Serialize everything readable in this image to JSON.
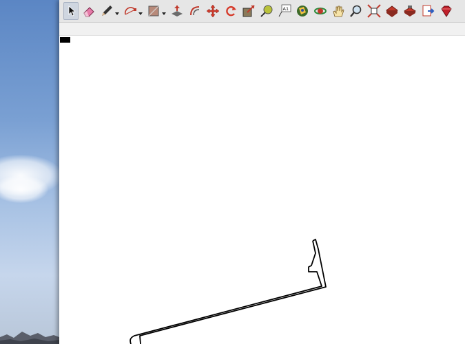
{
  "window": {
    "toolbar_tools": [
      {
        "name": "select-tool",
        "icon": "cursor-arrow-icon",
        "active": true
      },
      {
        "name": "eraser-tool",
        "icon": "eraser-icon"
      },
      {
        "name": "line-tool",
        "icon": "pencil-icon",
        "has_dropdown": true
      },
      {
        "name": "arc-tool",
        "icon": "arc-icon",
        "has_dropdown": true
      },
      {
        "name": "rectangle-tool",
        "icon": "rectangle-icon",
        "has_dropdown": true
      },
      {
        "name": "push-pull-tool",
        "icon": "push-pull-icon"
      },
      {
        "name": "offset-tool",
        "icon": "offset-icon"
      },
      {
        "name": "move-tool",
        "icon": "move-icon"
      },
      {
        "name": "rotate-tool",
        "icon": "rotate-icon"
      },
      {
        "name": "scale-tool",
        "icon": "scale-icon"
      },
      {
        "name": "tape-measure-tool",
        "icon": "tape-measure-icon"
      },
      {
        "name": "text-tool",
        "icon": "text-icon",
        "label": "A1"
      },
      {
        "name": "paint-bucket-tool",
        "icon": "paint-bucket-icon"
      },
      {
        "name": "orbit-tool",
        "icon": "orbit-icon"
      },
      {
        "name": "pan-tool",
        "icon": "hand-icon"
      },
      {
        "name": "zoom-tool",
        "icon": "magnifier-icon"
      },
      {
        "name": "zoom-extents-tool",
        "icon": "zoom-extents-icon"
      },
      {
        "name": "warehouse-tool",
        "icon": "warehouse-icon"
      },
      {
        "name": "extension-warehouse-tool",
        "icon": "extension-warehouse-icon"
      },
      {
        "name": "send-to-layout-tool",
        "icon": "send-to-layout-icon"
      },
      {
        "name": "ruby-console-tool",
        "icon": "ruby-icon"
      }
    ],
    "accent": "#c0392b"
  }
}
